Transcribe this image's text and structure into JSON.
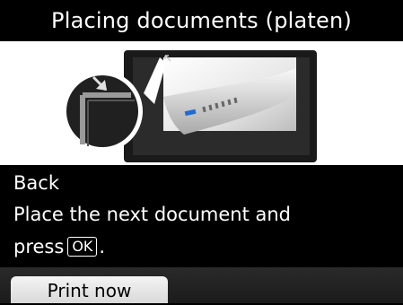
{
  "header": {
    "title": "Placing documents (platen)"
  },
  "illustration": {
    "zoom_icon": "alignment-mark-zoom-icon",
    "platen_icon": "platen-document-icon"
  },
  "message": {
    "line1": "Back",
    "line2": "Place the next document and",
    "line3_prefix": "press",
    "ok_key": "OK",
    "line3_suffix": "."
  },
  "softkey": {
    "print_now_label": "Print now"
  },
  "colors": {
    "background": "#000000",
    "text": "#ffffff",
    "button": "#e8e8e8"
  }
}
